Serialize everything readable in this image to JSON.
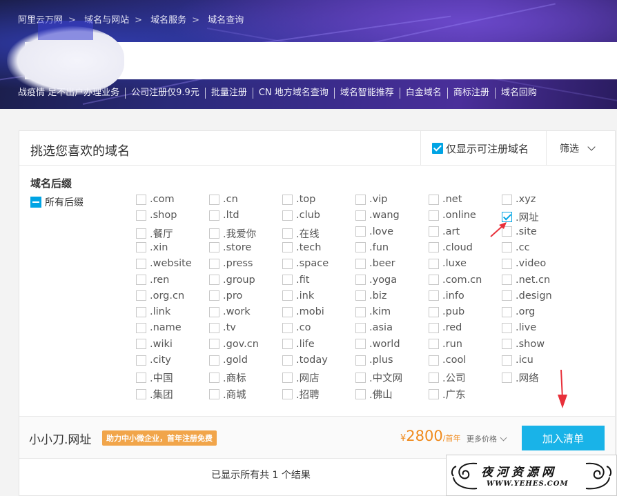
{
  "breadcrumb": [
    "阿里云万网",
    "域名与网站",
    "域名服务",
    "域名查询"
  ],
  "promo_links": [
    "战疫情 足不出户办理业务",
    "公司注册仅9.9元",
    "批量注册",
    "CN 地方域名查询",
    "域名智能推荐",
    "白金域名",
    "商标注册",
    "域名回购"
  ],
  "panel": {
    "title": "挑选您喜欢的域名",
    "only_available_label": "仅显示可注册域名",
    "filter_label": "筛选"
  },
  "suffix_section": {
    "title": "域名后缀",
    "all_label": "所有后缀",
    "columns": [
      [
        ".com",
        ".shop",
        ".餐厅",
        ".xin",
        ".website",
        ".ren",
        ".org.cn",
        ".link",
        ".name",
        ".wiki",
        ".city",
        ".中国",
        ".集团"
      ],
      [
        ".cn",
        ".ltd",
        ".我爱你",
        ".store",
        ".press",
        ".group",
        ".pro",
        ".work",
        ".tv",
        ".gov.cn",
        ".gold",
        ".商标",
        ".商城"
      ],
      [
        ".top",
        ".club",
        ".在线",
        ".tech",
        ".space",
        ".fit",
        ".ink",
        ".mobi",
        ".co",
        ".life",
        ".today",
        ".网店",
        ".招聘"
      ],
      [
        ".vip",
        ".wang",
        ".love",
        ".fun",
        ".beer",
        ".yoga",
        ".biz",
        ".kim",
        ".asia",
        ".world",
        ".plus",
        ".中文网",
        ".佛山"
      ],
      [
        ".net",
        ".online",
        ".art",
        ".cloud",
        ".luxe",
        ".com.cn",
        ".info",
        ".pub",
        ".red",
        ".run",
        ".cool",
        ".公司",
        ".广东"
      ],
      [
        ".xyz",
        ".网址",
        ".site",
        ".cc",
        ".video",
        ".net.cn",
        ".design",
        ".org",
        ".live",
        ".show",
        ".icu",
        ".网络"
      ]
    ],
    "checked": [
      ".网址"
    ]
  },
  "result": {
    "domain": "小小刀.网址",
    "badge": "助力中小微企业，首年注册免费",
    "currency": "¥",
    "price": "2800",
    "unit": "/首年",
    "more_price": "更多价格",
    "add_button": "加入清单"
  },
  "summary": "已显示所有共 1 个结果",
  "watermark": {
    "name": "夜河资源网",
    "url": "WWW.YEHES.COM"
  },
  "colors": {
    "accent": "#00a4e4",
    "price": "#f08a1c",
    "badge": "#f1a54a",
    "arrow": "#e8303a"
  }
}
